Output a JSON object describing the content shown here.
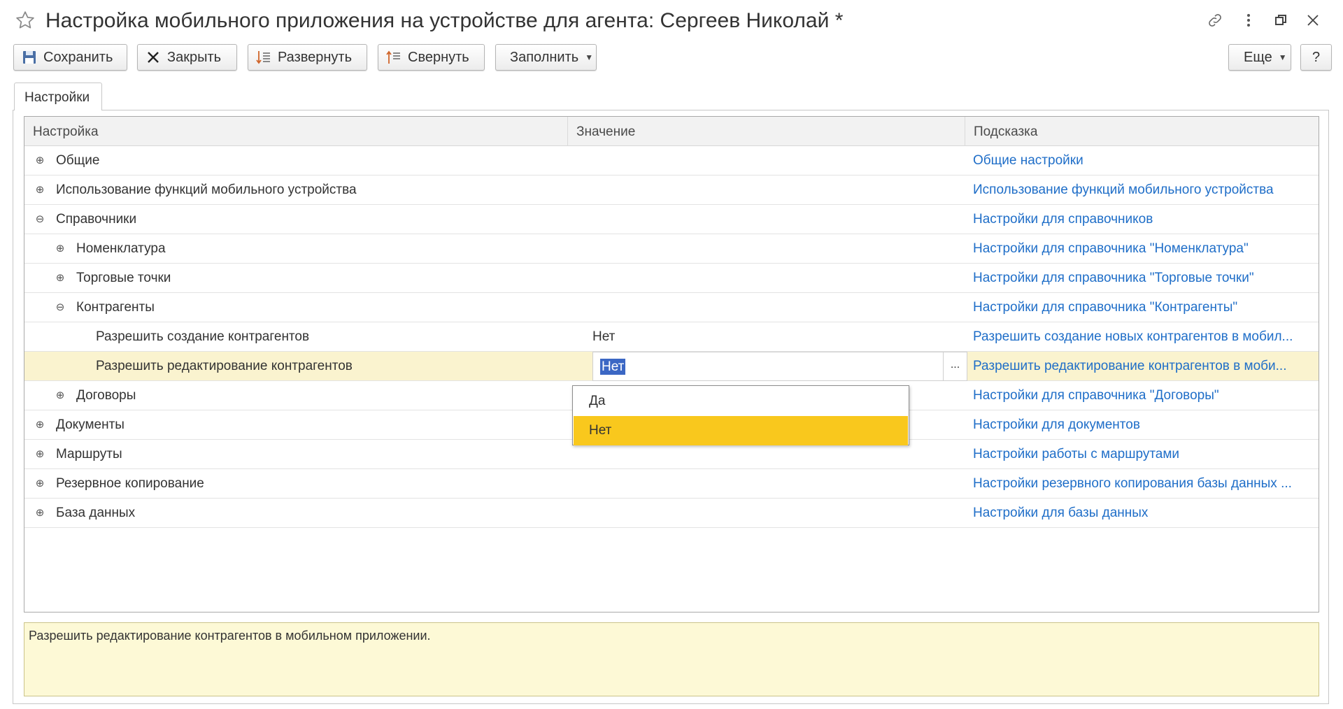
{
  "window": {
    "title": "Настройка мобильного приложения на устройстве для агента: Сергеев Николай *"
  },
  "toolbar": {
    "save": "Сохранить",
    "close": "Закрыть",
    "expand": "Развернуть",
    "collapse": "Свернуть",
    "fill": "Заполнить",
    "more": "Еще",
    "help": "?"
  },
  "tabs": [
    {
      "label": "Настройки"
    }
  ],
  "grid": {
    "columns": [
      "Настройка",
      "Значение",
      "Подсказка"
    ],
    "rows": [
      {
        "level": 0,
        "toggle": "plus",
        "name": "Общие",
        "value": "",
        "hint": "Общие настройки"
      },
      {
        "level": 0,
        "toggle": "plus",
        "name": "Использование функций мобильного устройства",
        "value": "",
        "hint": "Использование функций мобильного устройства"
      },
      {
        "level": 0,
        "toggle": "minus",
        "name": "Справочники",
        "value": "",
        "hint": "Настройки для справочников"
      },
      {
        "level": 1,
        "toggle": "plus",
        "name": "Номенклатура",
        "value": "",
        "hint": "Настройки для справочника \"Номенклатура\""
      },
      {
        "level": 1,
        "toggle": "plus",
        "name": "Торговые точки",
        "value": "",
        "hint": "Настройки для справочника \"Торговые точки\""
      },
      {
        "level": 1,
        "toggle": "minus",
        "name": "Контрагенты",
        "value": "",
        "hint": "Настройки для справочника \"Контрагенты\""
      },
      {
        "level": 2,
        "toggle": "none",
        "name": "Разрешить создание контрагентов",
        "value": "Нет",
        "hint": "Разрешить создание новых контрагентов в мобил..."
      },
      {
        "level": 2,
        "toggle": "none",
        "name": "Разрешить редактирование контрагентов",
        "value": "Нет",
        "hint": "Разрешить редактирование контрагентов в моби...",
        "selected": true
      },
      {
        "level": 1,
        "toggle": "plus",
        "name": "Договоры",
        "value": "",
        "hint": "Настройки для справочника \"Договоры\""
      },
      {
        "level": 0,
        "toggle": "plus",
        "name": "Документы",
        "value": "",
        "hint": "Настройки для документов"
      },
      {
        "level": 0,
        "toggle": "plus",
        "name": "Маршруты",
        "value": "",
        "hint": "Настройки работы с маршрутами"
      },
      {
        "level": 0,
        "toggle": "plus",
        "name": "Резервное копирование",
        "value": "",
        "hint": "Настройки резервного копирования базы данных ..."
      },
      {
        "level": 0,
        "toggle": "plus",
        "name": "База данных",
        "value": "",
        "hint": "Настройки для базы данных"
      }
    ]
  },
  "editor": {
    "value": "Нет",
    "choice_button": "..."
  },
  "dropdown": {
    "options": [
      "Да",
      "Нет"
    ],
    "selected": "Нет"
  },
  "hint_panel": {
    "text": "Разрешить редактирование контрагентов в мобильном приложении."
  }
}
